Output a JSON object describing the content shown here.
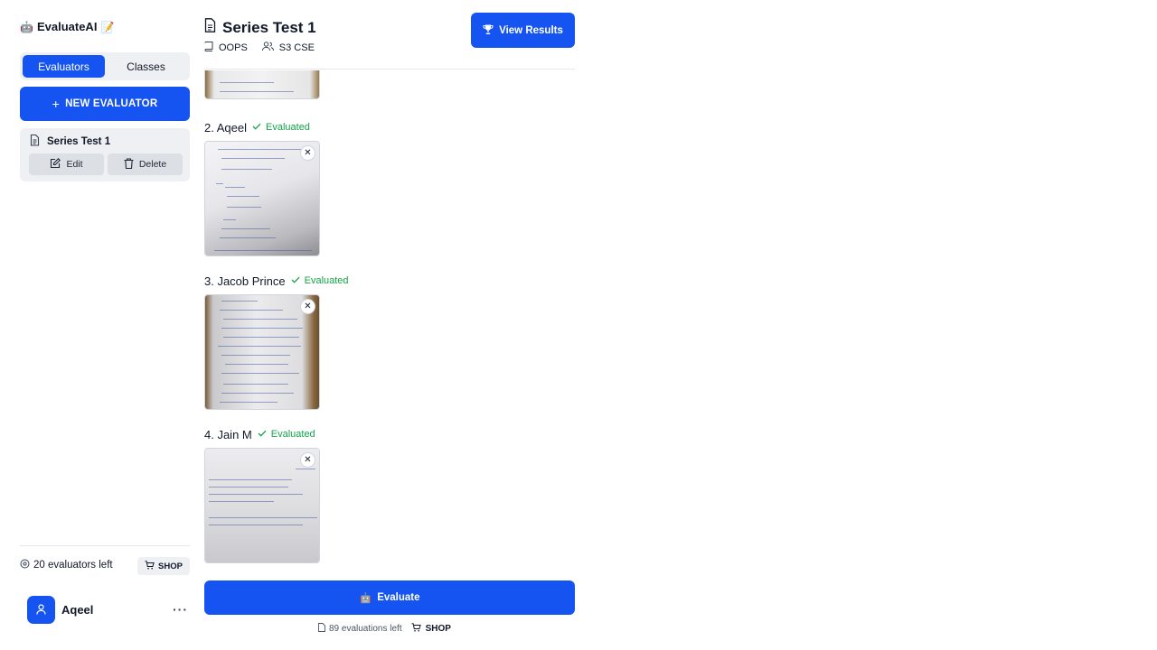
{
  "app": {
    "brand_name": "EvaluateAI",
    "brand_prefix_icon": "robot-emoji",
    "brand_suffix_icon": "memo-emoji",
    "accent_color": "#1554f0",
    "success_color": "#16a34a"
  },
  "sidebar": {
    "tabs": [
      {
        "label": "Evaluators",
        "active": true
      },
      {
        "label": "Classes",
        "active": false
      }
    ],
    "new_button_label": "NEW EVALUATOR",
    "evaluators": [
      {
        "title": "Series Test 1",
        "edit_label": "Edit",
        "delete_label": "Delete"
      }
    ],
    "evaluators_left": "20 evaluators left",
    "shop_label": "SHOP",
    "user_name": "Aqeel"
  },
  "main": {
    "title": "Series Test 1",
    "subject": "OOPS",
    "class_name": "S3 CSE",
    "results_button_label": "View Results",
    "submissions": [
      {
        "label": "2. Aqeel",
        "status": "Evaluated"
      },
      {
        "label": "3. Jacob Prince",
        "status": "Evaluated"
      },
      {
        "label": "4. Jain M",
        "status": "Evaluated"
      }
    ],
    "evaluate_button_label": "Evaluate",
    "evaluations_left": "89 evaluations left",
    "shop_label": "SHOP"
  }
}
